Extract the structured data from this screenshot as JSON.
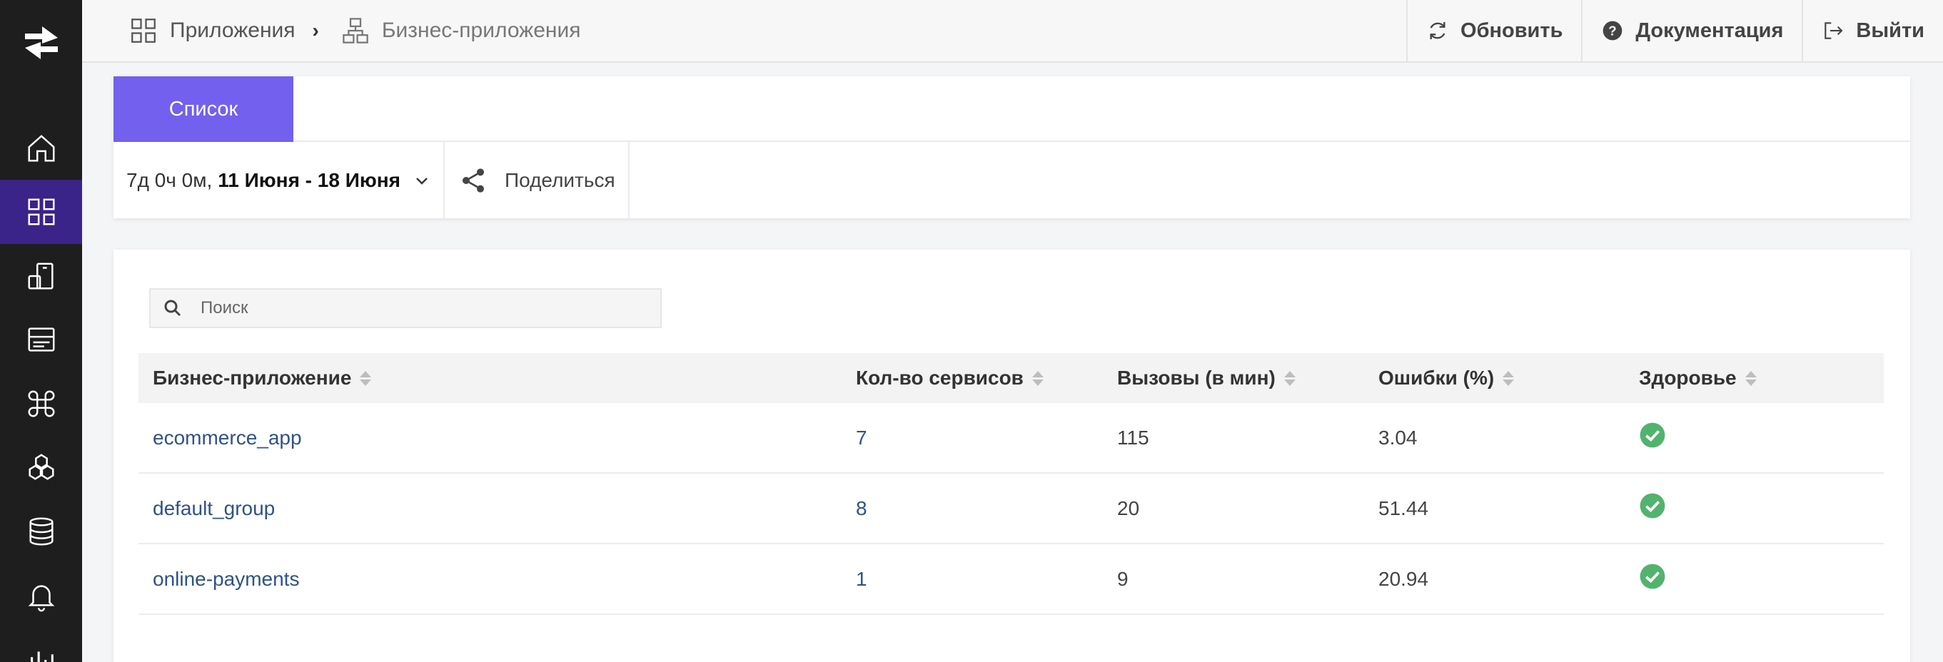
{
  "breadcrumb": {
    "apps_label": "Приложения",
    "separator": "›",
    "current_label": "Бизнес-приложения"
  },
  "top_actions": {
    "refresh_label": "Обновить",
    "docs_label": "Документация",
    "logout_label": "Выйти"
  },
  "sidebar": {
    "items": [
      "home-icon",
      "apps-grid-icon",
      "devices-icon",
      "server-icon",
      "command-icon",
      "cubes-icon",
      "database-icon",
      "bell-icon",
      "chart-icon"
    ],
    "active_index": 1
  },
  "tabs": [
    {
      "label": "Список",
      "active": true
    }
  ],
  "filters": {
    "duration": "7д 0ч 0м,",
    "range": "11 Июня - 18 Июня",
    "share_label": "Поделиться"
  },
  "search": {
    "placeholder": "Поиск",
    "value": ""
  },
  "table": {
    "headers": [
      "Бизнес-приложение",
      "Кол-во сервисов",
      "Вызовы (в мин)",
      "Ошибки (%)",
      "Здоровье"
    ],
    "rows": [
      {
        "name": "ecommerce_app",
        "services": "7",
        "calls": "115",
        "errors": "3.04",
        "health": "ok"
      },
      {
        "name": "default_group",
        "services": "8",
        "calls": "20",
        "errors": "51.44",
        "health": "ok"
      },
      {
        "name": "online-payments",
        "services": "1",
        "calls": "9",
        "errors": "20.94",
        "health": "ok"
      }
    ]
  },
  "colors": {
    "accent": "#7460ee",
    "sidebar_bg": "#1e1e1e",
    "sidebar_active": "#3a2389",
    "link": "#2f5289",
    "health_ok": "#52b36e"
  }
}
